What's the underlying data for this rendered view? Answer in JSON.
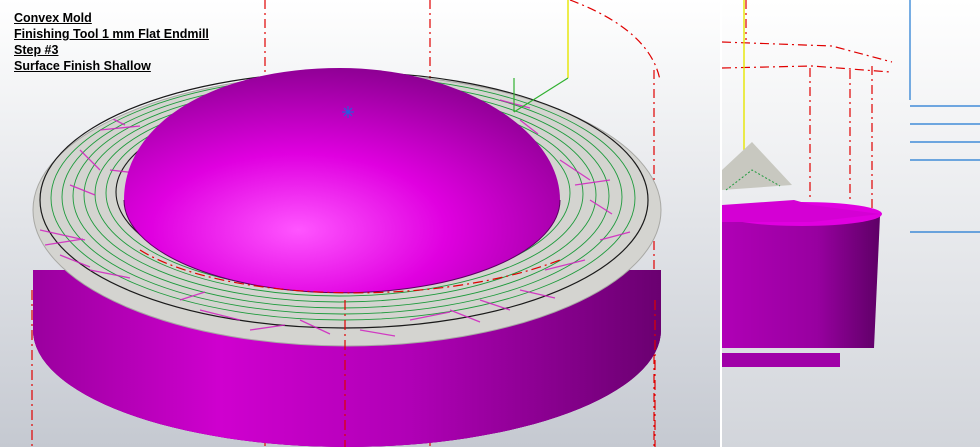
{
  "annotation": {
    "lines": [
      "Convex Mold",
      "Finishing Tool 1 mm Flat Endmill",
      "Step #3",
      "Surface Finish Shallow"
    ]
  },
  "colors": {
    "background_top": "#ffffff",
    "background_bottom": "#c5c9d1",
    "part_magenta": "#cc00cc",
    "part_magenta_dark": "#7a0080",
    "stock_gray": "#d4d4d0",
    "toolpath_green": "#1e9a3c",
    "toolpath_pink": "#d020c0",
    "boundary_red": "#e00000",
    "axis_yellow": "#e6e600",
    "axis_blue": "#1e78d2",
    "axis_green": "#30b030"
  }
}
